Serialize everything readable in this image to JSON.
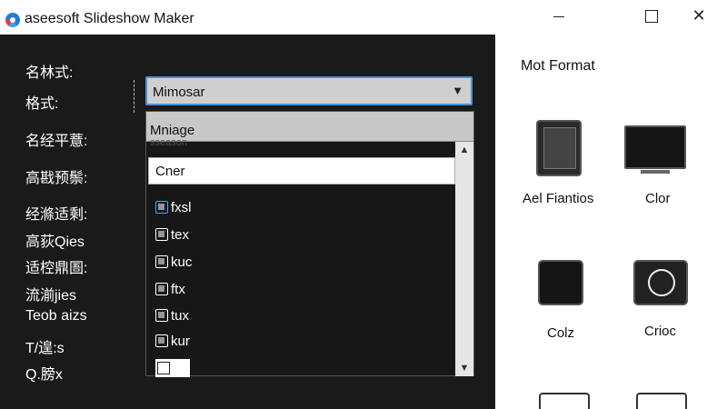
{
  "window": {
    "title": "aseesoft Slideshow Maker",
    "logo_icon": "aiseesoft-logo-icon"
  },
  "form": {
    "labels": [
      "名林式:",
      "格式:",
      "名经平薏:",
      "高戡预鬃:",
      "经滌适剩:",
      "高荻Qies",
      "适椌鼎圄:",
      "流湔jies",
      "Teob aizs",
      "T/遑:s",
      "Q.膀x"
    ],
    "format_select": {
      "value": "Mimosar",
      "arrow_icon": "chevron-down-icon"
    }
  },
  "dropdown": {
    "header": "Mniage",
    "ghost_text": "sseason",
    "selected": "Cner",
    "items": [
      {
        "label": "fxsl",
        "icon": "file-icon"
      },
      {
        "label": "tex",
        "icon": "file-icon"
      },
      {
        "label": "kuc",
        "icon": "file-icon"
      },
      {
        "label": "ftx",
        "icon": "file-icon"
      },
      {
        "label": "tux",
        "icon": "file-icon"
      },
      {
        "label": "kur",
        "icon": "file-icon"
      }
    ]
  },
  "right_panel": {
    "title": "Mot Format",
    "formats": [
      {
        "label": "Ael Fiantios",
        "icon": "tablet-icon"
      },
      {
        "label": "Clor",
        "icon": "monitor-icon"
      },
      {
        "label": "Colz",
        "icon": "square-device-icon"
      },
      {
        "label": "Crioc",
        "icon": "camera-icon"
      }
    ]
  },
  "colors": {
    "left_panel_bg": "#1a1a1a",
    "accent": "#4a90d9",
    "select_bg": "#cfcfcf"
  }
}
